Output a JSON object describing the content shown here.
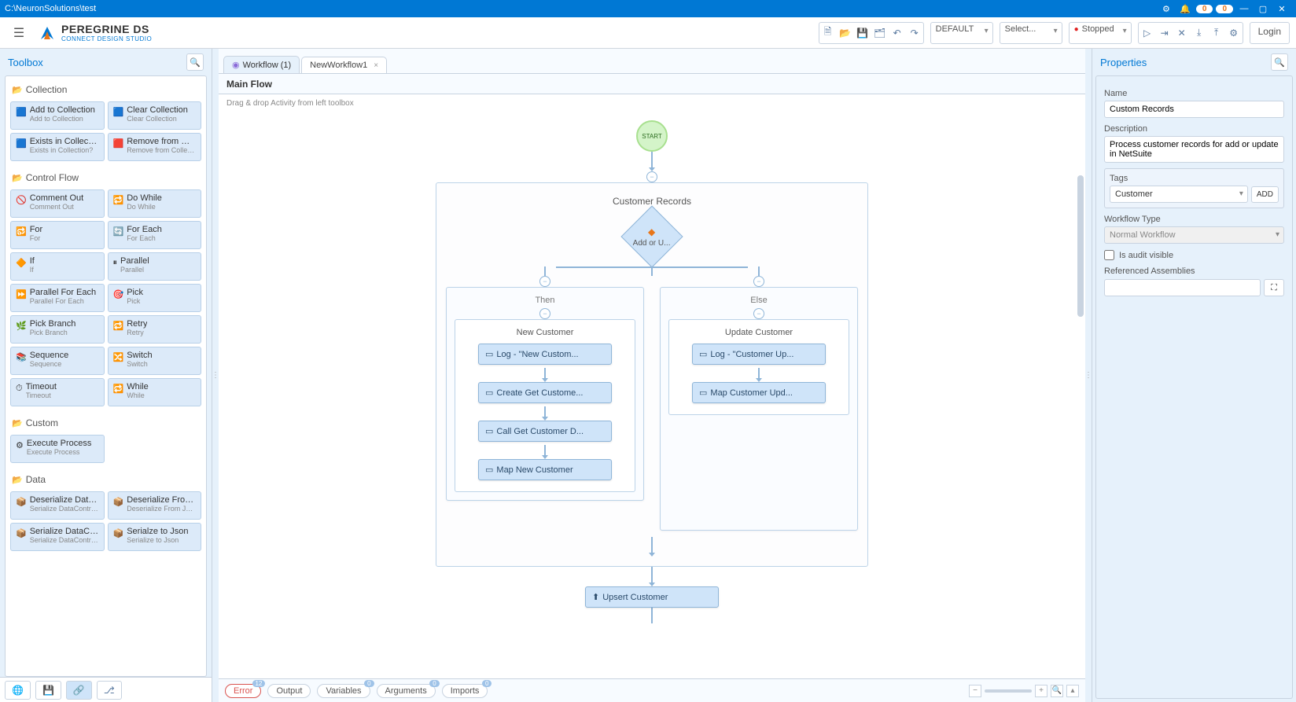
{
  "titlebar": {
    "path": "C:\\NeuronSolutions\\test",
    "badge1": "0",
    "badge2": "0"
  },
  "logo": {
    "name": "PEREGRINE DS",
    "sub": "CONNECT   DESIGN STUDIO"
  },
  "toolbar": {
    "select1": "DEFAULT",
    "select2": "Select...",
    "status": "Stopped",
    "login": "Login"
  },
  "toolbox": {
    "title": "Toolbox",
    "categories": [
      {
        "name": "Collection",
        "items": [
          {
            "t": "Add to Collection",
            "s": "Add to Collection",
            "icon": "🟦"
          },
          {
            "t": "Clear Collection",
            "s": "Clear Collection",
            "icon": "🟦"
          },
          {
            "t": "Exists in Collectio...",
            "s": "Exists in Collection?",
            "icon": "🟦"
          },
          {
            "t": "Remove from Col...",
            "s": "Remove from Collection",
            "icon": "🟥"
          }
        ]
      },
      {
        "name": "Control Flow",
        "items": [
          {
            "t": "Comment Out",
            "s": "Comment Out",
            "icon": "🚫"
          },
          {
            "t": "Do While",
            "s": "Do While",
            "icon": "🔁"
          },
          {
            "t": "For",
            "s": "For",
            "icon": "🔂"
          },
          {
            "t": "For Each",
            "s": "For Each",
            "icon": "🔄"
          },
          {
            "t": "If",
            "s": "If",
            "icon": "🔶"
          },
          {
            "t": "Parallel",
            "s": "Parallel",
            "icon": "⏸"
          },
          {
            "t": "Parallel For Each",
            "s": "Parallel For Each",
            "icon": "⏩"
          },
          {
            "t": "Pick",
            "s": "Pick",
            "icon": "🎯"
          },
          {
            "t": "Pick Branch",
            "s": "Pick Branch",
            "icon": "🌿"
          },
          {
            "t": "Retry",
            "s": "Retry",
            "icon": "🔁"
          },
          {
            "t": "Sequence",
            "s": "Sequence",
            "icon": "📚"
          },
          {
            "t": "Switch",
            "s": "Switch",
            "icon": "🔀"
          },
          {
            "t": "Timeout",
            "s": "Timeout",
            "icon": "⏱"
          },
          {
            "t": "While",
            "s": "While",
            "icon": "🔁"
          }
        ]
      },
      {
        "name": "Custom",
        "items": [
          {
            "t": "Execute Process",
            "s": "Execute Process",
            "icon": "⚙"
          }
        ]
      },
      {
        "name": "Data",
        "items": [
          {
            "t": "Deserialize DataC...",
            "s": "Serialize DataContract",
            "icon": "📦"
          },
          {
            "t": "Deserialize From ...",
            "s": "Deserialize From Json",
            "icon": "📦"
          },
          {
            "t": "Serialize DataCo...",
            "s": "Serialize DataContract",
            "icon": "📦"
          },
          {
            "t": "Serialze to Json",
            "s": "Serialize to Json",
            "icon": "📦"
          }
        ]
      }
    ]
  },
  "tabs": [
    {
      "label": "Workflow (1)",
      "closable": false,
      "active": false
    },
    {
      "label": "NewWorkflow1",
      "closable": true,
      "active": true
    }
  ],
  "subheader": "Main Flow",
  "canvas": {
    "hint": "Drag & drop Activity from left toolbox",
    "start": "START",
    "container_title": "Customer Records",
    "decision": "Add or U...",
    "then_label": "Then",
    "else_label": "Else",
    "then_title": "New Customer",
    "else_title": "Update Customer",
    "then_acts": [
      "Log - \"New Custom...",
      "Create Get Custome...",
      "Call Get Customer D...",
      "Map New Customer"
    ],
    "else_acts": [
      "Log - \"Customer Up...",
      "Map Customer Upd..."
    ],
    "final": "Upsert Customer"
  },
  "bottom_tabs": {
    "error": "Error",
    "error_badge": "12",
    "output": "Output",
    "variables": "Variables",
    "variables_badge": "0",
    "arguments": "Arguments",
    "arguments_badge": "0",
    "imports": "Imports",
    "imports_badge": "0"
  },
  "properties": {
    "title": "Properties",
    "name_label": "Name",
    "name_value": "Custom Records",
    "desc_label": "Description",
    "desc_value": "Process customer records for add or update in NetSuite",
    "tags_label": "Tags",
    "tags_value": "Customer",
    "add_label": "ADD",
    "wftype_label": "Workflow Type",
    "wftype_value": "Normal Workflow",
    "audit_label": "Is audit visible",
    "ref_label": "Referenced Assemblies"
  }
}
